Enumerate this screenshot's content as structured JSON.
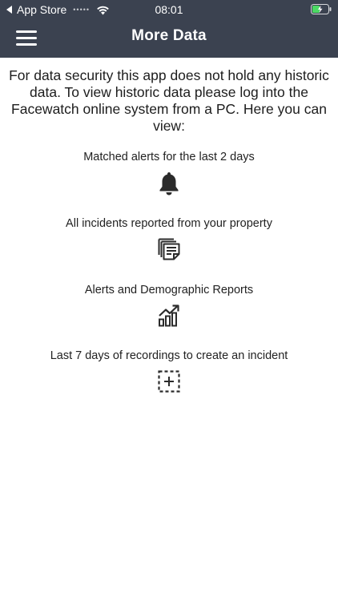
{
  "status_bar": {
    "back_app": "App Store",
    "signal": "•••••",
    "time": "08:01"
  },
  "nav": {
    "title": "More Data"
  },
  "intro": "For data security this app does not hold any historic data. To view historic data please log into the Facewatch online system from a PC. Here you can view:",
  "sections": [
    {
      "label": "Matched alerts for the last 2 days",
      "icon": "bell-icon"
    },
    {
      "label": "All incidents reported from your property",
      "icon": "documents-icon"
    },
    {
      "label": "Alerts and Demographic Reports",
      "icon": "chart-growth-icon"
    },
    {
      "label": "Last 7 days of recordings to create an incident",
      "icon": "add-selection-icon"
    }
  ],
  "colors": {
    "header_bg": "#3b4250",
    "header_text": "#ffffff",
    "body_text": "#1d1d1d",
    "icon": "#2b2b2b"
  }
}
